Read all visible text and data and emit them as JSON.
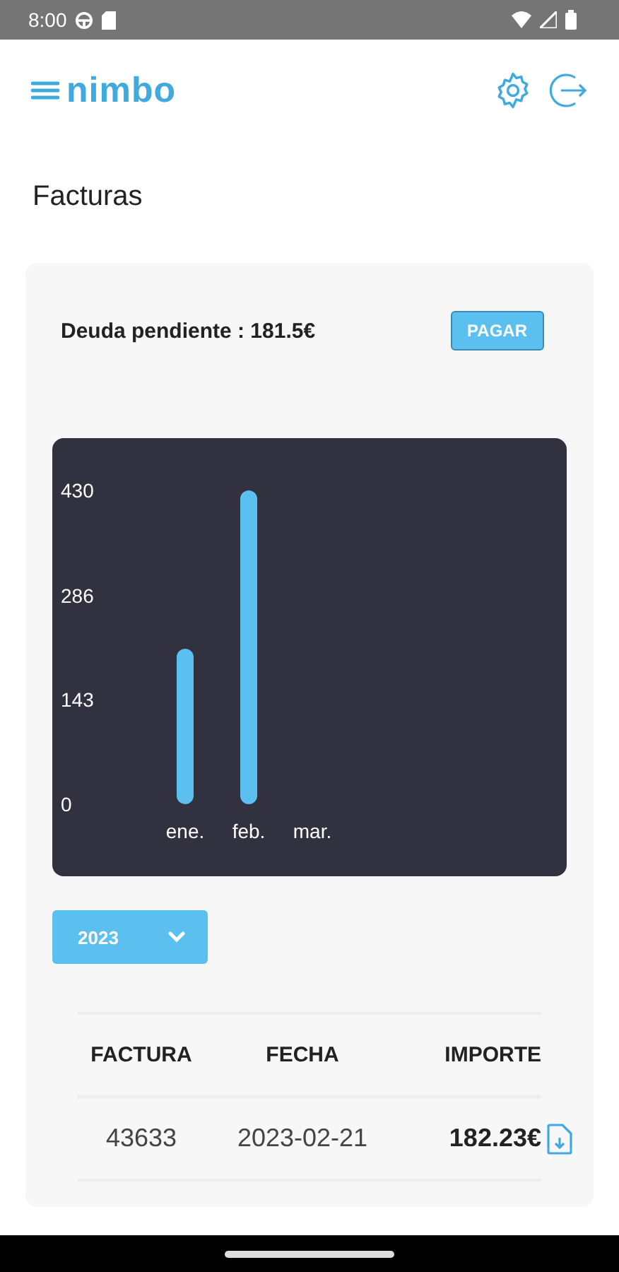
{
  "status_bar": {
    "time": "8:00"
  },
  "header": {
    "logo": "nimbo"
  },
  "page_title": "Facturas",
  "debt": {
    "label": "Deuda pendiente : 181.5€",
    "button": "PAGAR"
  },
  "chart_data": {
    "type": "bar",
    "categories": [
      "ene.",
      "feb.",
      "mar."
    ],
    "values": [
      213,
      430,
      null
    ],
    "ylim": [
      0,
      430
    ],
    "yticks": [
      0,
      143,
      286,
      430
    ]
  },
  "year_select": {
    "value": "2023"
  },
  "table": {
    "columns": [
      "FACTURA",
      "FECHA",
      "IMPORTE"
    ],
    "rows": [
      {
        "factura": "43633",
        "fecha": "2023-02-21",
        "importe": "182.23€"
      }
    ]
  }
}
